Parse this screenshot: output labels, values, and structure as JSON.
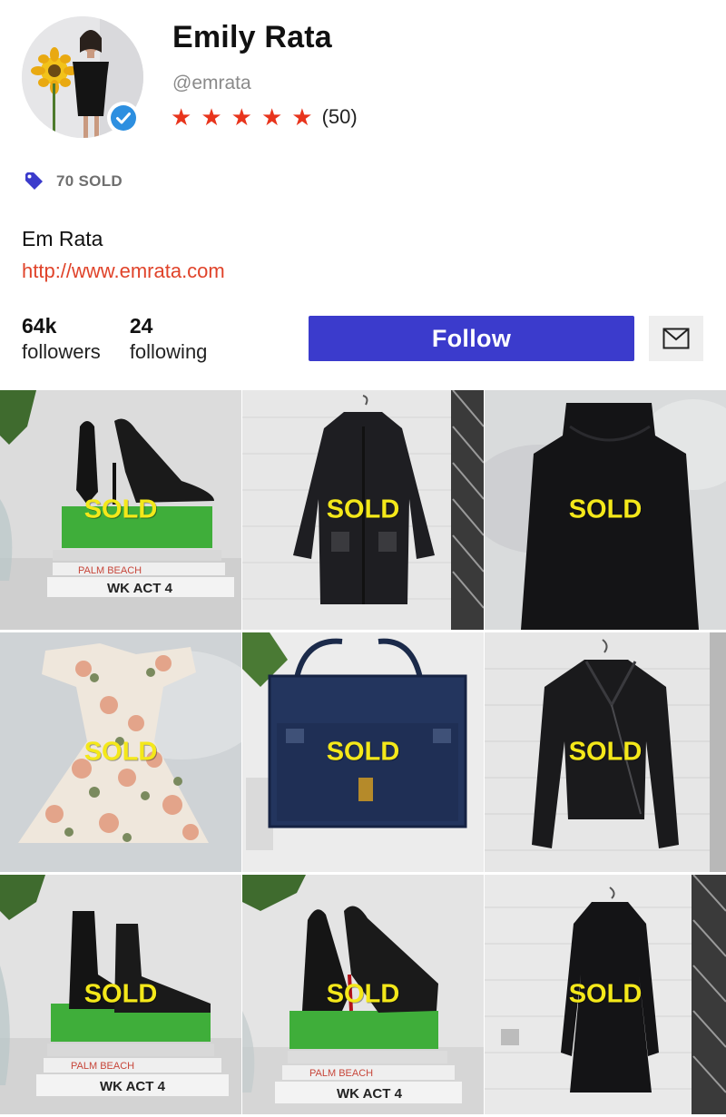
{
  "profile": {
    "name": "Emily Rata",
    "handle": "@emrata",
    "rating": 5,
    "review_count": "(50)",
    "sold_count": "70 SOLD",
    "bio": "Em Rata",
    "website": "http://www.emrata.com"
  },
  "stats": {
    "followers_count": "64k",
    "followers_label": "followers",
    "following_count": "24",
    "following_label": "following"
  },
  "actions": {
    "follow_label": "Follow"
  },
  "colors": {
    "star": "#e8341c",
    "follow_button": "#3b3bcc",
    "website_link": "#e0432a",
    "sold_overlay": "#f4e81a",
    "badge_icon": "#3b3bcc",
    "verified_badge": "#2d8fe0"
  },
  "icons": {
    "sold_badge": "tag-icon",
    "verified": "verified-check-icon",
    "message": "mail-icon"
  },
  "listings": [
    {
      "item": "black-heels-on-books",
      "status": "SOLD"
    },
    {
      "item": "black-coat",
      "status": "SOLD"
    },
    {
      "item": "black-dress",
      "status": "SOLD"
    },
    {
      "item": "floral-dress",
      "status": "SOLD"
    },
    {
      "item": "navy-tote-bag",
      "status": "SOLD"
    },
    {
      "item": "leather-jacket",
      "status": "SOLD"
    },
    {
      "item": "black-ankle-boots",
      "status": "SOLD"
    },
    {
      "item": "black-platform-heels",
      "status": "SOLD"
    },
    {
      "item": "black-long-sleeve-dress",
      "status": "SOLD"
    }
  ],
  "book_spines": {
    "palm_beach": "PALM BEACH",
    "wk_act": "WK ACT 4"
  }
}
